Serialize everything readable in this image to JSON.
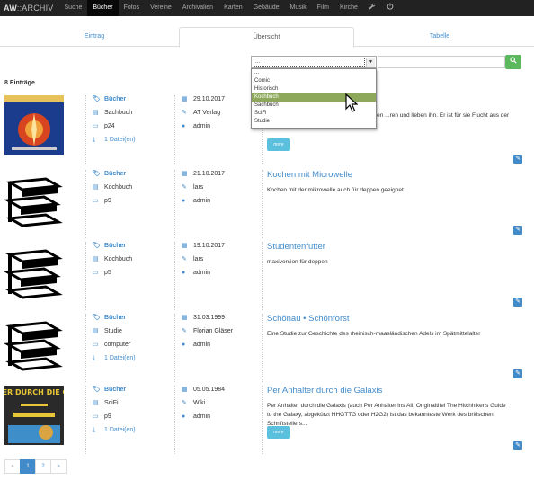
{
  "nav": {
    "brand_bold": "AW",
    "brand_rest": "::ARCHIV",
    "items": [
      "Suche",
      "Bücher",
      "Fotos",
      "Vereine",
      "Archivalien",
      "Karten",
      "Gebäude",
      "Musik",
      "Film",
      "Kirche"
    ],
    "active": "Bücher",
    "icons": [
      "wrench-icon",
      "power-icon"
    ]
  },
  "tabs": [
    "Eintrag",
    "Übersicht",
    "Tabelle"
  ],
  "search": {
    "select_value": "...",
    "options": [
      "...",
      "Comic",
      "Historisch",
      "Kochbuch",
      "Sachbuch",
      "SciFi",
      "Studie"
    ],
    "highlighted": "Kochbuch",
    "query": ""
  },
  "count_label": "8 Einträge",
  "entries": [
    {
      "type": "Bücher",
      "category": "Sachbuch",
      "location": "p24",
      "files": "1 Datei(en)",
      "date": "29.10.2017",
      "author": "AT Verlag",
      "user": "admin",
      "title": "",
      "description": "...ur Anwendung Die Naturvölker kennen den ...ren und lieben ihn. Er ist für sie Flucht aus der Wirklichkeit, religiöse Erfahrung...",
      "more": "more",
      "thumb": "cover-esoteric",
      "thumb_color": "#1a3a8a"
    },
    {
      "type": "Bücher",
      "category": "Kochbuch",
      "location": "p9",
      "files": "",
      "date": "21.10.2017",
      "author": "lars",
      "user": "admin",
      "title": "Kochen mit Microwelle",
      "description": "Kochen mit der mikrowelle auch für deppen geeignet",
      "more": "",
      "thumb": "books-icon"
    },
    {
      "type": "Bücher",
      "category": "Kochbuch",
      "location": "p5",
      "files": "",
      "date": "19.10.2017",
      "author": "lars",
      "user": "admin",
      "title": "Studentenfutter",
      "description": "maxiversion für deppen",
      "more": "",
      "thumb": "books-icon"
    },
    {
      "type": "Bücher",
      "category": "Studie",
      "location": "computer",
      "files": "1 Datei(en)",
      "date": "31.03.1999",
      "author": "Florian Gläser",
      "user": "admin",
      "title": "Schönau • Schönforst",
      "description": "Eine Studie zur Geschichte des rheinisch-maasländischen Adels im Spätmittelalter",
      "more": "",
      "thumb": "books-icon"
    },
    {
      "type": "Bücher",
      "category": "SciFi",
      "location": "p9",
      "files": "1 Datei(en)",
      "date": "05.05.1984",
      "author": "Wiki",
      "user": "admin",
      "title": "Per Anhalter durch die Galaxis",
      "description": "Per Anhalter durch die Galaxis (auch Per Anhalter ins All; Originaltitel The Hitchhiker's Guide to the Galaxy, abgekürzt HHGTTG oder H2G2) ist das bekannteste Werk des britischen Schriftstellers...",
      "more": "more",
      "thumb": "cover-hitchhiker",
      "cover_text": "ANHALTER DURCH DIE GALAXIS"
    }
  ],
  "pagination": [
    "«",
    "1",
    "2",
    "»"
  ],
  "colors": {
    "accent": "#428bca",
    "success": "#5cb85c",
    "info": "#5bc0de",
    "navbar": "#222222"
  }
}
